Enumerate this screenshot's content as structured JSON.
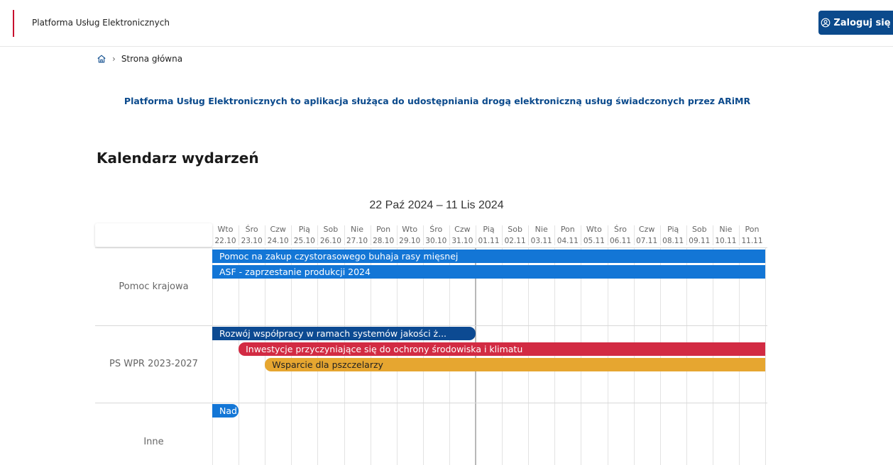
{
  "header": {
    "brand": "Platforma Usług Elektronicznych",
    "login_label": "Zaloguj się"
  },
  "breadcrumb": {
    "items": [
      "Strona główna"
    ]
  },
  "intro_text": "Platforma Usług Elektronicznych to aplikacja służąca do udostępniania drogą elektroniczną usług świadczonych przez ARiMR",
  "page_title": "Kalendarz wydarzeń",
  "calendar": {
    "range": "22 Paź 2024 – 11 Lis 2024",
    "days": [
      {
        "dow": "Wto",
        "date": "22.10"
      },
      {
        "dow": "Śro",
        "date": "23.10"
      },
      {
        "dow": "Czw",
        "date": "24.10"
      },
      {
        "dow": "Pią",
        "date": "25.10"
      },
      {
        "dow": "Sob",
        "date": "26.10"
      },
      {
        "dow": "Nie",
        "date": "27.10"
      },
      {
        "dow": "Pon",
        "date": "28.10"
      },
      {
        "dow": "Wto",
        "date": "29.10"
      },
      {
        "dow": "Śro",
        "date": "30.10"
      },
      {
        "dow": "Czw",
        "date": "31.10"
      },
      {
        "dow": "Pią",
        "date": "01.11"
      },
      {
        "dow": "Sob",
        "date": "02.11"
      },
      {
        "dow": "Nie",
        "date": "03.11"
      },
      {
        "dow": "Pon",
        "date": "04.11"
      },
      {
        "dow": "Wto",
        "date": "05.11"
      },
      {
        "dow": "Śro",
        "date": "06.11"
      },
      {
        "dow": "Czw",
        "date": "07.11"
      },
      {
        "dow": "Pią",
        "date": "08.11"
      },
      {
        "dow": "Sob",
        "date": "09.11"
      },
      {
        "dow": "Nie",
        "date": "10.11"
      },
      {
        "dow": "Pon",
        "date": "11.11"
      }
    ],
    "today_date": "01.11",
    "groups": [
      {
        "label": "Pomoc krajowa",
        "events": [
          {
            "title": "Pomoc na zakup czystorasowego buhaja rasy mięsnej",
            "start": "22.10",
            "end": "11.11",
            "color": "#1376d6",
            "lane": 0,
            "starts_before": true,
            "ends_after": true
          },
          {
            "title": "ASF - zaprzestanie produkcji 2024",
            "start": "22.10",
            "end": "11.11",
            "color": "#1376d6",
            "lane": 1,
            "starts_before": true,
            "ends_after": true
          }
        ]
      },
      {
        "label": "PS WPR 2023-2027",
        "events": [
          {
            "title": "Rozwój współpracy w ramach systemów jakości ż...",
            "start": "22.10",
            "end": "31.10",
            "color": "#0c4a92",
            "lane": 0,
            "starts_before": true,
            "ends_after": false
          },
          {
            "title": "Inwestycje przyczyniające się do ochrony środowiska i klimatu",
            "start": "23.10",
            "end": "11.11",
            "color": "#d22b43",
            "lane": 1,
            "starts_before": false,
            "ends_after": true
          },
          {
            "title": "Wsparcie dla pszczelarzy",
            "start": "24.10",
            "end": "11.11",
            "color": "#e6a630",
            "lane": 2,
            "starts_before": false,
            "ends_after": true
          }
        ]
      },
      {
        "label": "Inne",
        "events": [
          {
            "title": "Nad",
            "start": "22.10",
            "end": "22.10",
            "color": "#1376d6",
            "lane": 0,
            "starts_before": true,
            "ends_after": false
          }
        ]
      }
    ]
  }
}
